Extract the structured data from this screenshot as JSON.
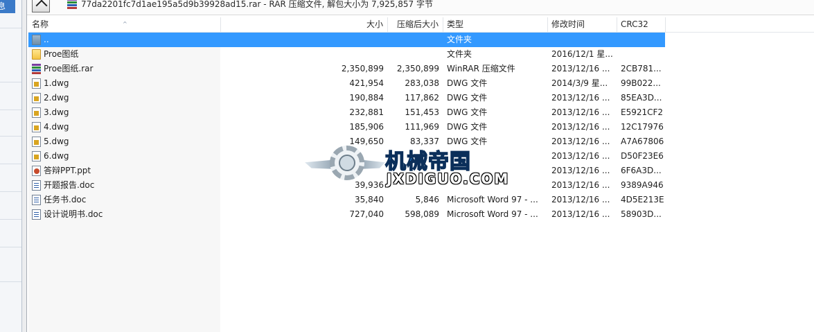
{
  "left_panel": {
    "tab_text": "息"
  },
  "address_bar": {
    "text": "77da2201fc7d1ae195a5d9b39928ad15.rar - RAR 压缩文件, 解包大小为 7,925,857 字节"
  },
  "columns": {
    "name": "名称",
    "size": "大小",
    "packed": "压缩后大小",
    "type": "类型",
    "modified": "修改时间",
    "crc": "CRC32"
  },
  "rows": [
    {
      "name": "..",
      "size": "",
      "packed": "",
      "type": "文件夹",
      "modified": "",
      "crc": "",
      "icon": "parent-folder-icon",
      "selected": true
    },
    {
      "name": "Proe图纸",
      "size": "",
      "packed": "",
      "type": "文件夹",
      "modified": "2016/12/1 星...",
      "crc": "",
      "icon": "folder-icon"
    },
    {
      "name": "Proe图纸.rar",
      "size": "2,350,899",
      "packed": "2,350,899",
      "type": "WinRAR 压缩文件",
      "modified": "2013/12/16 ...",
      "crc": "2CB781...",
      "icon": "rar-archive-icon"
    },
    {
      "name": "1.dwg",
      "size": "421,954",
      "packed": "283,038",
      "type": "DWG 文件",
      "modified": "2014/3/9 星...",
      "crc": "99B022...",
      "icon": "dwg-file-icon"
    },
    {
      "name": "2.dwg",
      "size": "190,884",
      "packed": "117,862",
      "type": "DWG 文件",
      "modified": "2013/12/16 ...",
      "crc": "85EA3D...",
      "icon": "dwg-file-icon"
    },
    {
      "name": "3.dwg",
      "size": "232,881",
      "packed": "151,453",
      "type": "DWG 文件",
      "modified": "2013/12/16 ...",
      "crc": "E5921CF2",
      "icon": "dwg-file-icon"
    },
    {
      "name": "4.dwg",
      "size": "185,906",
      "packed": "111,969",
      "type": "DWG 文件",
      "modified": "2013/12/16 ...",
      "crc": "12C17976",
      "icon": "dwg-file-icon"
    },
    {
      "name": "5.dwg",
      "size": "149,650",
      "packed": "83,337",
      "type": "DWG 文件",
      "modified": "2013/12/16 ...",
      "crc": "A7A67806",
      "icon": "dwg-file-icon"
    },
    {
      "name": "6.dwg",
      "size": "",
      "packed": "",
      "type": "",
      "modified": "2013/12/16 ...",
      "crc": "D50F23E6",
      "icon": "dwg-file-icon"
    },
    {
      "name": "答辩PPT.ppt",
      "size": "",
      "packed": "",
      "type": "",
      "modified": "2013/12/16 ...",
      "crc": "6F6A3D...",
      "icon": "ppt-file-icon"
    },
    {
      "name": "开题报告.doc",
      "size": "39,936",
      "packed": "",
      "type": "",
      "modified": "2013/12/16 ...",
      "crc": "9389A946",
      "icon": "doc-file-icon"
    },
    {
      "name": "任务书.doc",
      "size": "35,840",
      "packed": "5,846",
      "type": "Microsoft Word 97 - ...",
      "modified": "2013/12/16 ...",
      "crc": "4D5E213E",
      "icon": "doc-file-icon"
    },
    {
      "name": "设计说明书.doc",
      "size": "727,040",
      "packed": "598,089",
      "type": "Microsoft Word 97 - ...",
      "modified": "2013/12/16 ...",
      "crc": "58903D...",
      "icon": "doc-file-icon"
    }
  ],
  "watermark": {
    "cn": "机械帝国",
    "en": "JXDIGUO.COM"
  },
  "colors": {
    "selection": "#3399ff",
    "accent_blue": "#1f7fd6"
  }
}
